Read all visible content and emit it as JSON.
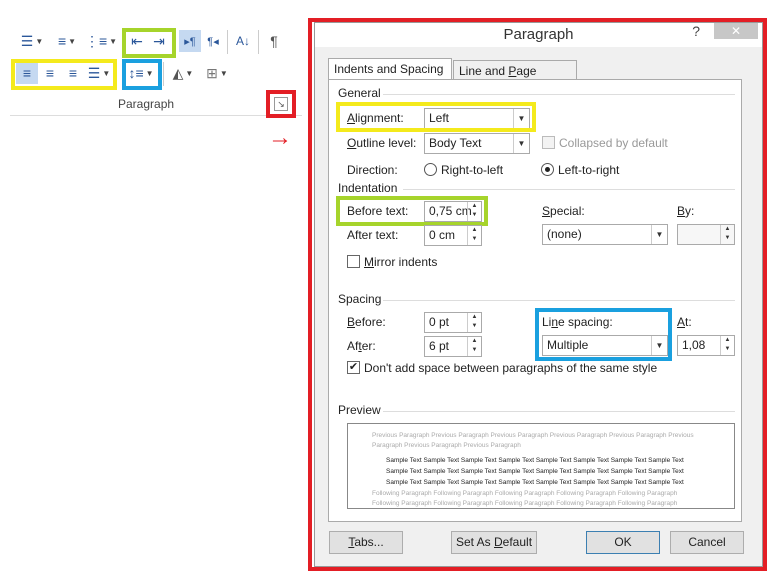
{
  "ribbon": {
    "group_label": "Paragraph",
    "icons": {
      "bullets": "bullets-icon",
      "numbering": "numbering-icon",
      "multilevel": "multilevel-list-icon",
      "decrease_indent": "decrease-indent-icon",
      "increase_indent": "increase-indent-icon",
      "ltr": "left-to-right-icon",
      "rtl": "right-to-left-icon",
      "sort": "sort-icon",
      "show_marks": "pilcrow-icon",
      "align_left": "align-left-icon",
      "center": "align-center-icon",
      "align_right": "align-right-icon",
      "justify": "justify-icon",
      "line_spacing": "line-spacing-icon",
      "shading": "shading-icon",
      "borders": "borders-icon",
      "launcher": "dialog-launcher-icon"
    }
  },
  "dialog": {
    "title": "Paragraph",
    "help": "?",
    "close": "✕",
    "tabs": [
      "Indents and Spacing",
      "Line and Page Breaks"
    ],
    "general": {
      "heading": "General",
      "alignment_label": "Alignment:",
      "alignment_value": "Left",
      "outline_label": "Outline level:",
      "outline_value": "Body Text",
      "collapsed_label": "Collapsed by default",
      "direction_label": "Direction:",
      "rtl_label": "Right-to-left",
      "ltr_label": "Left-to-right"
    },
    "indentation": {
      "heading": "Indentation",
      "before_label": "Before text:",
      "before_value": "0,75 cm",
      "after_label": "After text:",
      "after_value": "0 cm",
      "special_label": "Special:",
      "special_value": "(none)",
      "by_label": "By:",
      "by_value": "",
      "mirror_label": "Mirror indents"
    },
    "spacing": {
      "heading": "Spacing",
      "before_label": "Before:",
      "before_value": "0 pt",
      "after_label": "After:",
      "after_value": "6 pt",
      "line_spacing_label": "Line spacing:",
      "line_spacing_value": "Multiple",
      "at_label": "At:",
      "at_value": "1,08",
      "dont_add_label": "Don't add space between paragraphs of the same style"
    },
    "preview": {
      "heading": "Preview",
      "previous": "Previous Paragraph Previous Paragraph Previous Paragraph Previous Paragraph Previous Paragraph Previous Paragraph Previous Paragraph Previous Paragraph",
      "sample": "Sample Text Sample Text Sample Text Sample Text Sample Text Sample Text Sample Text Sample Text Sample Text Sample Text Sample Text Sample Text Sample Text Sample Text Sample Text Sample Text Sample Text Sample Text Sample Text Sample Text Sample Text Sample Text Sample Text Sample Text",
      "following": "Following Paragraph Following Paragraph Following Paragraph Following Paragraph Following Paragraph Following Paragraph Following Paragraph Following Paragraph Following Paragraph Following Paragraph Following Paragraph"
    },
    "buttons": {
      "tabs": "Tabs...",
      "set_default": "Set As Default",
      "ok": "OK",
      "cancel": "Cancel"
    }
  },
  "colors": {
    "highlight_yellow": "#f4ea1c",
    "highlight_green": "#a6d42b",
    "highlight_blue": "#1aa0df",
    "highlight_red": "#e31e25"
  }
}
